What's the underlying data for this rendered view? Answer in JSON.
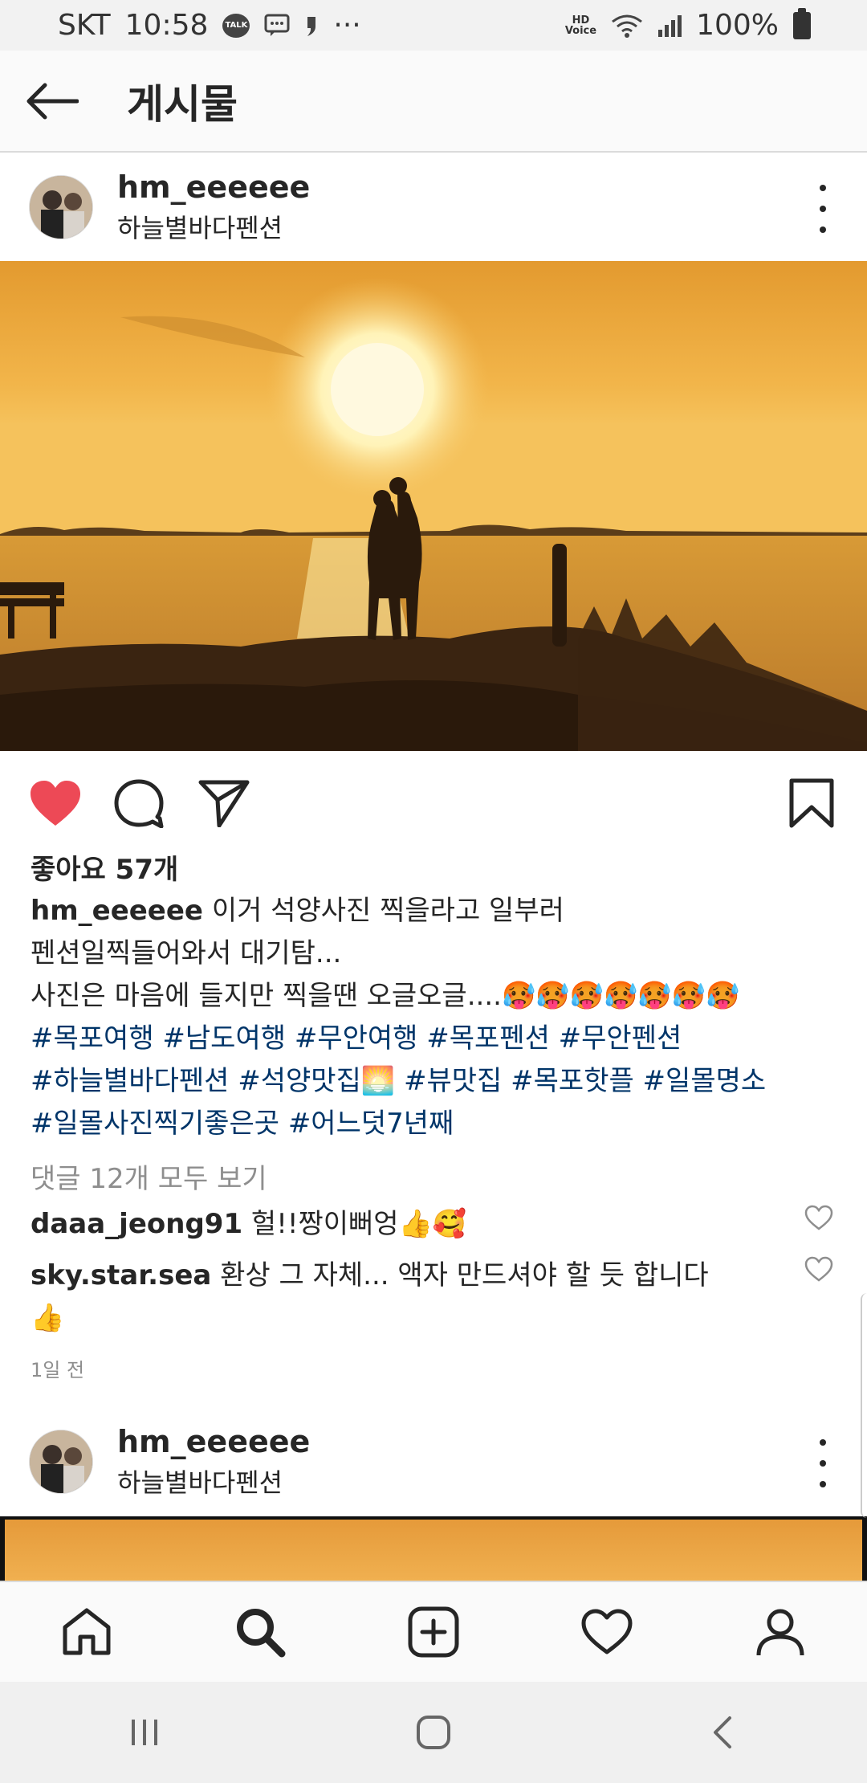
{
  "status_bar": {
    "carrier": "SKT",
    "time": "10:58",
    "talk": "TALK",
    "more": "···",
    "hd_line1": "HD",
    "hd_line2": "Voice",
    "battery": "100%"
  },
  "header": {
    "title": "게시물"
  },
  "post": {
    "username": "hm_eeeeee",
    "location": "하늘별바다펜션",
    "likes": "좋아요 57개",
    "caption_user": "hm_eeeeee",
    "caption_line1": "이거 석양사진 찍을라고 일부러",
    "caption_line2": "펜션일찍들어와서 대기탐...",
    "caption_line3": "사진은 마음에 들지만 찍을땐 오글오글....🥵🥵🥵🥵🥵🥵🥵",
    "tags_line1": "#목포여행 #남도여행 #무안여행 #목포펜션 #무안펜션",
    "tags_line2": "#하늘별바다펜션 #석양맛집🌅 #뷰맛집 #목포핫플 #일몰명소",
    "tags_line3": "#일몰사진찍기좋은곳 #어느덧7년째",
    "view_comments": "댓글 12개 모두 보기",
    "comments": [
      {
        "user": "daaa_jeong91",
        "text": "헐!!짱이뻐엉👍🥰"
      },
      {
        "user": "sky.star.sea",
        "text": "환상 그 자체... 액자 만드셔야 할 듯 합니다",
        "text2": "👍"
      }
    ],
    "time": "1일 전"
  },
  "next_post": {
    "username": "hm_eeeeee",
    "location": "하늘별바다펜션"
  },
  "colors": {
    "like_red": "#ed4956",
    "hashtag": "#003569",
    "muted": "#8e8e8e"
  },
  "icons": {
    "back": "arrow-left-icon",
    "more": "more-vertical-icon",
    "like": "heart-filled-icon",
    "comment": "comment-icon",
    "share": "send-icon",
    "save": "bookmark-icon",
    "home": "home-icon",
    "search": "search-icon",
    "add": "add-post-icon",
    "activity": "heart-outline-icon",
    "profile": "profile-icon"
  }
}
